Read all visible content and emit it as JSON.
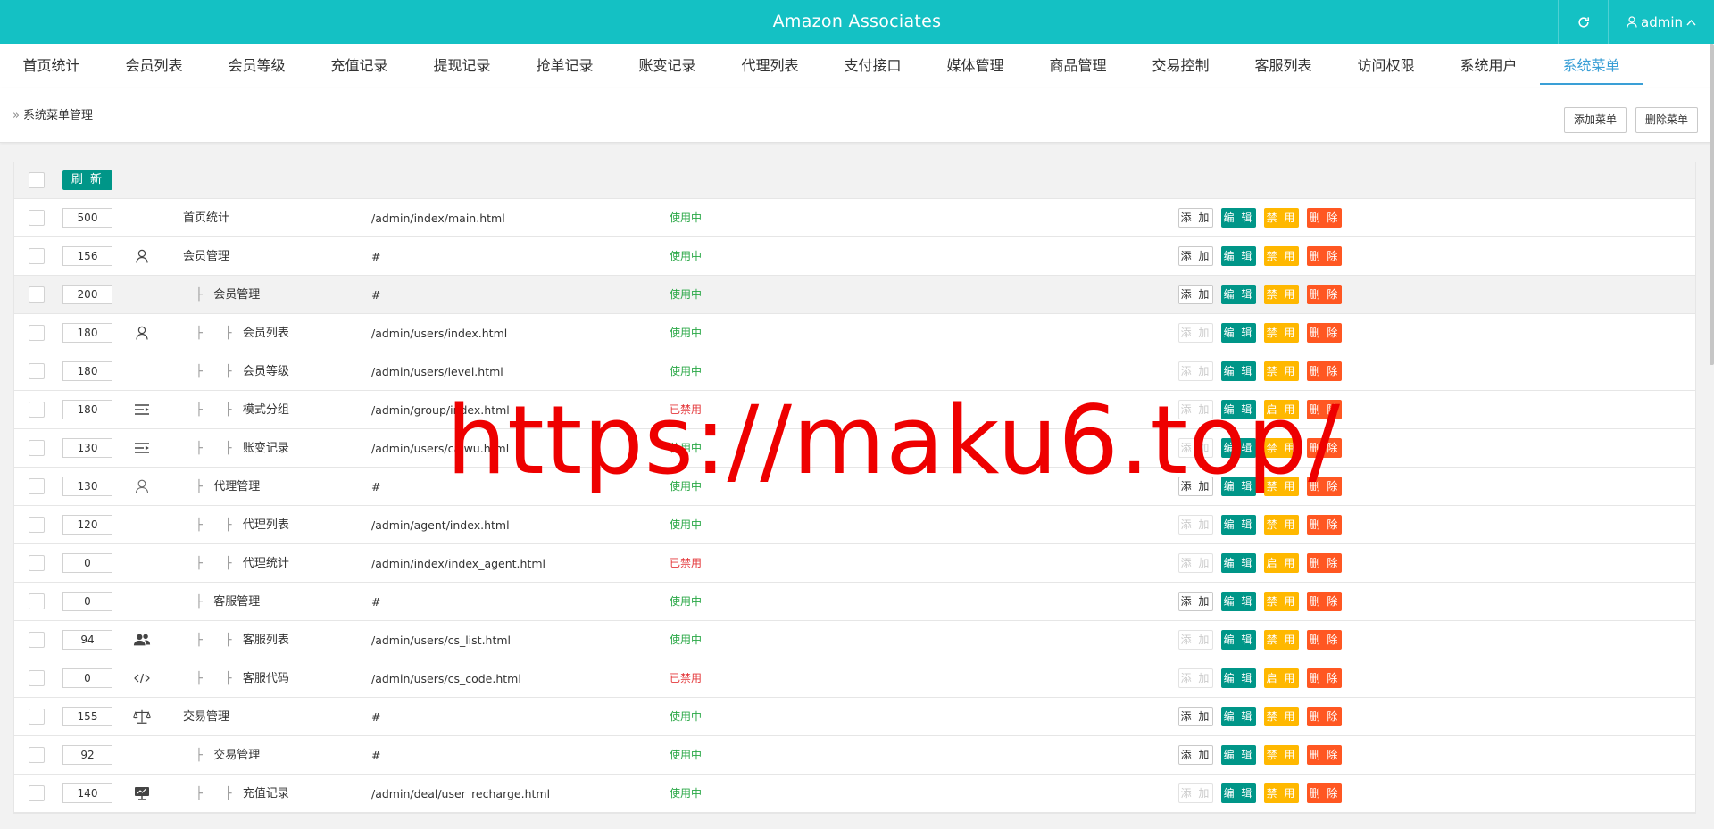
{
  "header": {
    "title": "Amazon Associates",
    "user": "admin"
  },
  "tabs": [
    "首页统计",
    "会员列表",
    "会员等级",
    "充值记录",
    "提现记录",
    "抢单记录",
    "账变记录",
    "代理列表",
    "支付接口",
    "媒体管理",
    "商品管理",
    "交易控制",
    "客服列表",
    "访问权限",
    "系统用户",
    "系统菜单"
  ],
  "breadcrumb": "系统菜单管理",
  "toolbar": {
    "add_menu": "添加菜单",
    "delete_menu": "删除菜单",
    "refresh": "刷 新"
  },
  "actions": {
    "add": "添 加",
    "edit": "编 辑",
    "disable": "禁 用",
    "enable": "启 用",
    "delete": "删 除"
  },
  "rows": [
    {
      "sort": "500",
      "icon": "",
      "level": 0,
      "name": "首页统计",
      "url": "/admin/index/main.html",
      "status": "使用中",
      "enabled": true,
      "can_add": true
    },
    {
      "sort": "156",
      "icon": "user-icon",
      "level": 0,
      "name": "会员管理",
      "url": "#",
      "status": "使用中",
      "enabled": true,
      "can_add": true
    },
    {
      "sort": "200",
      "icon": "",
      "level": 1,
      "name": "会员管理",
      "url": "#",
      "status": "使用中",
      "enabled": true,
      "can_add": true
    },
    {
      "sort": "180",
      "icon": "user-icon",
      "level": 2,
      "name": "会员列表",
      "url": "/admin/users/index.html",
      "status": "使用中",
      "enabled": true,
      "can_add": false
    },
    {
      "sort": "180",
      "icon": "",
      "level": 2,
      "name": "会员等级",
      "url": "/admin/users/level.html",
      "status": "使用中",
      "enabled": true,
      "can_add": false
    },
    {
      "sort": "180",
      "icon": "list-icon",
      "level": 2,
      "name": "模式分组",
      "url": "/admin/group/index.html",
      "status": "已禁用",
      "enabled": false,
      "can_add": false
    },
    {
      "sort": "130",
      "icon": "list-icon",
      "level": 2,
      "name": "账变记录",
      "url": "/admin/users/caiwu.html",
      "status": "使用中",
      "enabled": true,
      "can_add": false
    },
    {
      "sort": "130",
      "icon": "agent-icon",
      "level": 1,
      "name": "代理管理",
      "url": "#",
      "status": "使用中",
      "enabled": true,
      "can_add": true
    },
    {
      "sort": "120",
      "icon": "",
      "level": 2,
      "name": "代理列表",
      "url": "/admin/agent/index.html",
      "status": "使用中",
      "enabled": true,
      "can_add": false
    },
    {
      "sort": "0",
      "icon": "",
      "level": 2,
      "name": "代理统计",
      "url": "/admin/index/index_agent.html",
      "status": "已禁用",
      "enabled": false,
      "can_add": false
    },
    {
      "sort": "0",
      "icon": "",
      "level": 1,
      "name": "客服管理",
      "url": "#",
      "status": "使用中",
      "enabled": true,
      "can_add": true
    },
    {
      "sort": "94",
      "icon": "users-icon",
      "level": 2,
      "name": "客服列表",
      "url": "/admin/users/cs_list.html",
      "status": "使用中",
      "enabled": true,
      "can_add": false
    },
    {
      "sort": "0",
      "icon": "code-icon",
      "level": 2,
      "name": "客服代码",
      "url": "/admin/users/cs_code.html",
      "status": "已禁用",
      "enabled": false,
      "can_add": false
    },
    {
      "sort": "155",
      "icon": "scale-icon",
      "level": 0,
      "name": "交易管理",
      "url": "#",
      "status": "使用中",
      "enabled": true,
      "can_add": true
    },
    {
      "sort": "92",
      "icon": "",
      "level": 1,
      "name": "交易管理",
      "url": "#",
      "status": "使用中",
      "enabled": true,
      "can_add": true
    },
    {
      "sort": "140",
      "icon": "monitor-icon",
      "level": 2,
      "name": "充值记录",
      "url": "/admin/deal/user_recharge.html",
      "status": "使用中",
      "enabled": true,
      "can_add": false
    }
  ],
  "watermark": "https://maku6.top/",
  "colors": {
    "header": "#14c1c4",
    "active_tab": "#3a9fd6",
    "edit": "#009688",
    "toggle": "#ffb800",
    "delete": "#ff5722",
    "status_on": "#28a745",
    "status_off": "#e4393c"
  }
}
